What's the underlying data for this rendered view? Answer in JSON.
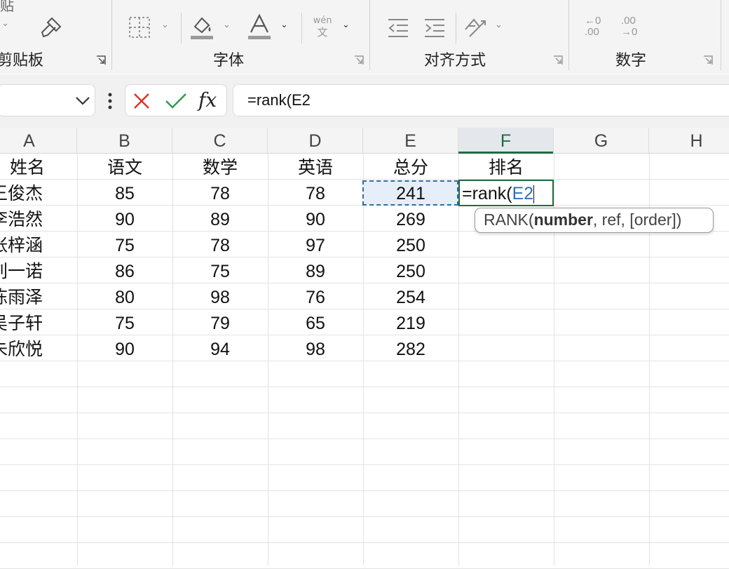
{
  "ribbon": {
    "groups": [
      {
        "title": "剪贴板"
      },
      {
        "title": "字体"
      },
      {
        "title": "对齐方式"
      },
      {
        "title": "数字"
      }
    ],
    "partial_top_label": "贴",
    "phonetic_top": "wén",
    "phonetic_bottom": "文",
    "dec_increase_top": "←0",
    "dec_increase_bottom": ".00",
    "dec_decrease_top": ".00",
    "dec_decrease_bottom": "→0"
  },
  "formula_bar": {
    "fx_label": "fx",
    "formula": "=rank(E2"
  },
  "columns": [
    "A",
    "B",
    "C",
    "D",
    "E",
    "F",
    "G",
    "H"
  ],
  "active_column": "F",
  "rows": [
    [
      "姓名",
      "语文",
      "数学",
      "英语",
      "总分",
      "排名"
    ],
    [
      "王俊杰",
      "85",
      "78",
      "78",
      "241",
      ""
    ],
    [
      "李浩然",
      "90",
      "89",
      "90",
      "269",
      ""
    ],
    [
      "张梓涵",
      "75",
      "78",
      "97",
      "250",
      ""
    ],
    [
      "刘一诺",
      "86",
      "75",
      "89",
      "250",
      ""
    ],
    [
      "陈雨泽",
      "80",
      "98",
      "76",
      "254",
      ""
    ],
    [
      "吴子轩",
      "75",
      "79",
      "65",
      "219",
      ""
    ],
    [
      "朱欣悦",
      "90",
      "94",
      "98",
      "282",
      ""
    ]
  ],
  "edit_cell": {
    "prefix": "=rank(",
    "ref": "E2"
  },
  "tooltip": {
    "fn": "RANK(",
    "arg_bold": "number",
    "rest": ", ref, [order])"
  },
  "colors": {
    "accent_green": "#1e6b41",
    "ref_blue": "#2f6fbf",
    "cancel_red": "#d9342b",
    "confirm_green": "#2e9b4f"
  }
}
